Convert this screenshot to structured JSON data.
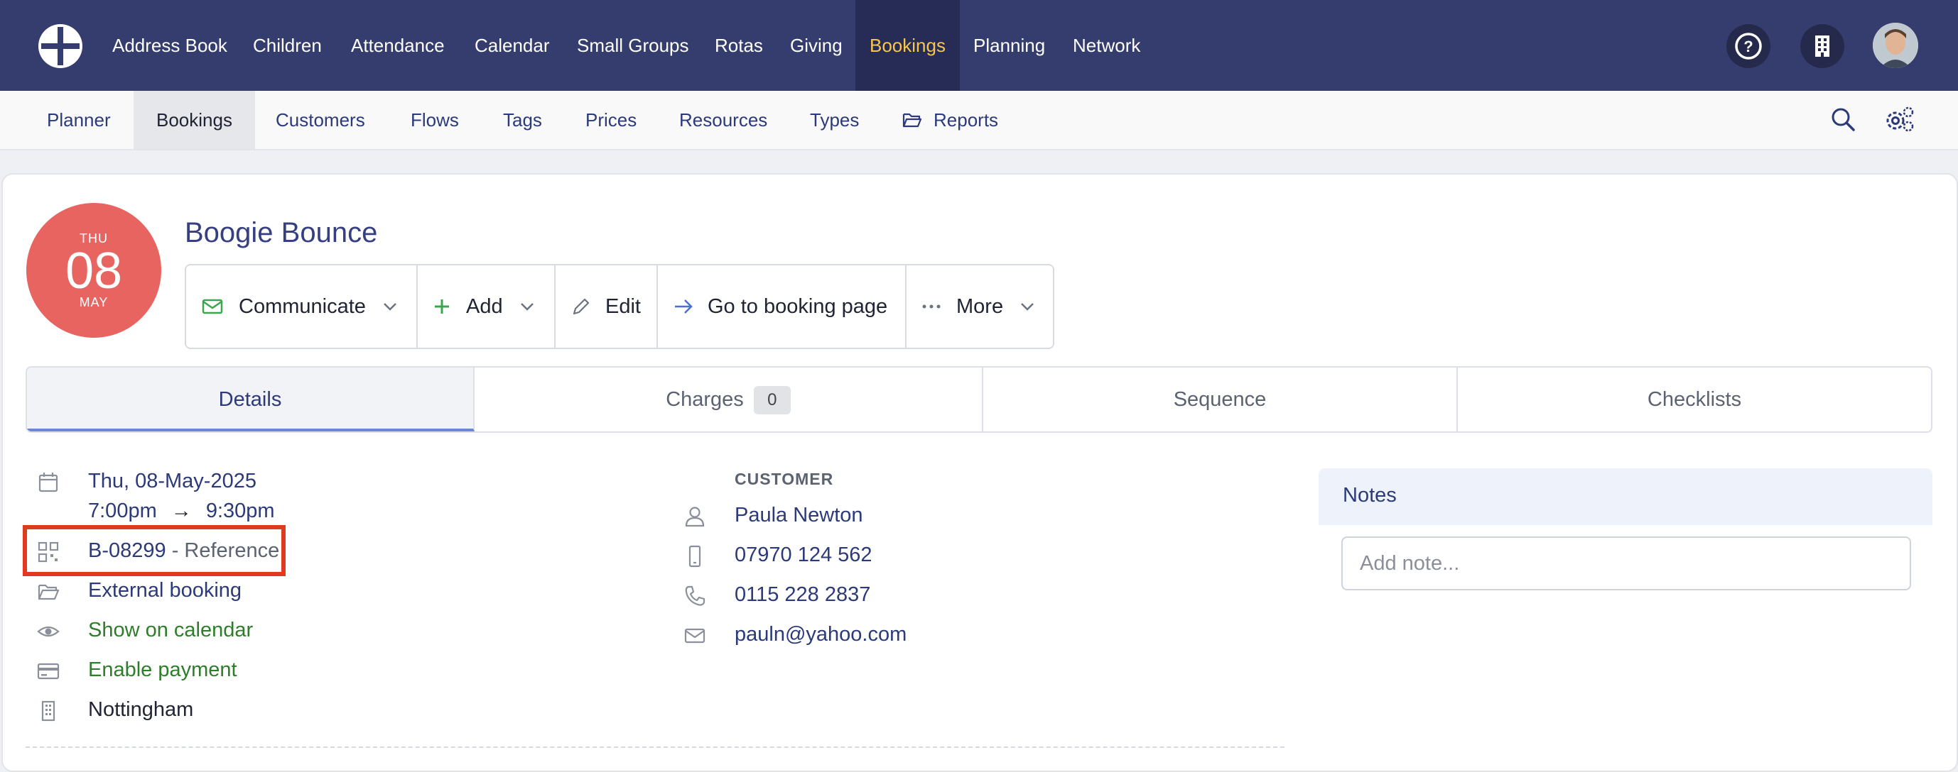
{
  "topnav": {
    "items": [
      "Address Book",
      "Children",
      "Attendance",
      "Calendar",
      "Small Groups",
      "Rotas",
      "Giving",
      "Bookings",
      "Planning",
      "Network"
    ],
    "active": "Bookings",
    "icons": [
      "help-icon",
      "building-icon",
      "avatar"
    ]
  },
  "subnav": {
    "items": [
      "Planner",
      "Bookings",
      "Customers",
      "Flows",
      "Tags",
      "Prices",
      "Resources",
      "Types",
      "Reports"
    ],
    "active": "Bookings"
  },
  "booking": {
    "date_badge": {
      "dow": "THU",
      "day": "08",
      "month": "MAY"
    },
    "title": "Boogie Bounce",
    "actions": {
      "communicate": "Communicate",
      "add": "Add",
      "edit": "Edit",
      "goto": "Go to booking page",
      "more": "More"
    }
  },
  "tabs": {
    "details": "Details",
    "charges": "Charges",
    "charges_count": "0",
    "sequence": "Sequence",
    "checklists": "Checklists"
  },
  "details": {
    "date": "Thu, 08-May-2025",
    "start": "7:00pm",
    "arrow": "→",
    "end": "9:30pm",
    "reference": "B-08299",
    "reference_suffix": " - Reference",
    "folder": "External booking",
    "visibility": "Show on calendar",
    "payment": "Enable payment",
    "location": "Nottingham"
  },
  "customer": {
    "label": "CUSTOMER",
    "name": "Paula Newton",
    "mobile": "07970 124 562",
    "phone": "0115 228 2837",
    "email": "pauln@yahoo.com"
  },
  "notes": {
    "title": "Notes",
    "placeholder": "Add note..."
  },
  "colors": {
    "nav_bg": "#343d6d",
    "active_nav": "#f7c64a",
    "date_badge": "#e86461",
    "link": "#2c3a7a",
    "green": "#2e7d2a",
    "highlight": "#e03a1f"
  }
}
